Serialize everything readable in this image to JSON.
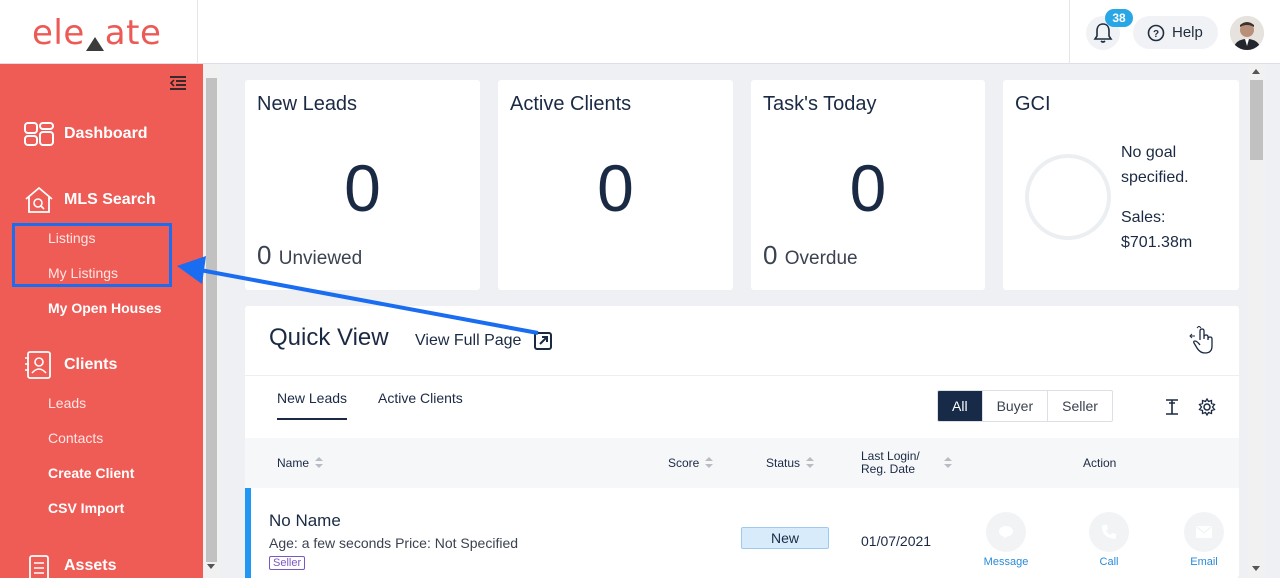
{
  "app": {
    "logo_text": "ele",
    "logo_text_b": "ate"
  },
  "header": {
    "notification_count": "38",
    "help_label": "Help"
  },
  "sidebar": {
    "sections": [
      {
        "label": "Dashboard"
      },
      {
        "label": "MLS Search",
        "items": [
          "Listings",
          "My Listings",
          "My Open Houses"
        ]
      },
      {
        "label": "Clients",
        "items": [
          "Leads",
          "Contacts",
          "Create Client",
          "CSV Import"
        ]
      },
      {
        "label": "Assets"
      }
    ]
  },
  "cards": [
    {
      "title": "New Leads",
      "value": "0",
      "sub_value": "0",
      "sub_label": "Unviewed"
    },
    {
      "title": "Active Clients",
      "value": "0"
    },
    {
      "title": "Task's Today",
      "value": "0",
      "sub_value": "0",
      "sub_label": "Overdue"
    },
    {
      "title": "GCI",
      "goal_line1": "No goal",
      "goal_line2": "specified.",
      "sales_label": "Sales:",
      "sales_value": "$701.38m"
    }
  ],
  "quick_view": {
    "title": "Quick View",
    "view_full_page": "View Full Page",
    "tabs": [
      "New Leads",
      "Active Clients"
    ],
    "filters": [
      "All",
      "Buyer",
      "Seller"
    ],
    "columns": {
      "name": "Name",
      "score": "Score",
      "status": "Status",
      "last_login_1": "Last Login/",
      "last_login_2": "Reg. Date",
      "action": "Action"
    },
    "rows": [
      {
        "name": "No Name",
        "meta": "Age: a few seconds Price: Not Specified",
        "tag": "Seller",
        "status": "New",
        "date": "01/07/2021",
        "actions": [
          "Message",
          "Call",
          "Email"
        ]
      }
    ]
  },
  "colors": {
    "sidebar": "#ef5b55",
    "accent": "#1a6cf0",
    "navy": "#172a47",
    "link": "#2a8bd8"
  }
}
